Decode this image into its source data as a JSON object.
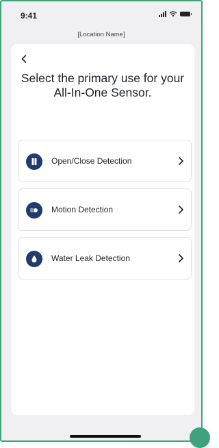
{
  "status_bar": {
    "time": "9:41"
  },
  "header": {
    "location_name": "[Location Name]"
  },
  "page": {
    "title": "Select the primary use for your All-In-One Sensor."
  },
  "options": [
    {
      "label": "Open/Close Detection",
      "icon": "door-icon"
    },
    {
      "label": "Motion Detection",
      "icon": "motion-icon"
    },
    {
      "label": "Water Leak Detection",
      "icon": "water-drop-icon"
    }
  ],
  "colors": {
    "accent": "#3fa37a",
    "icon_badge": "#1f3c6e",
    "background": "#f0f0f2",
    "card": "#ffffff"
  }
}
